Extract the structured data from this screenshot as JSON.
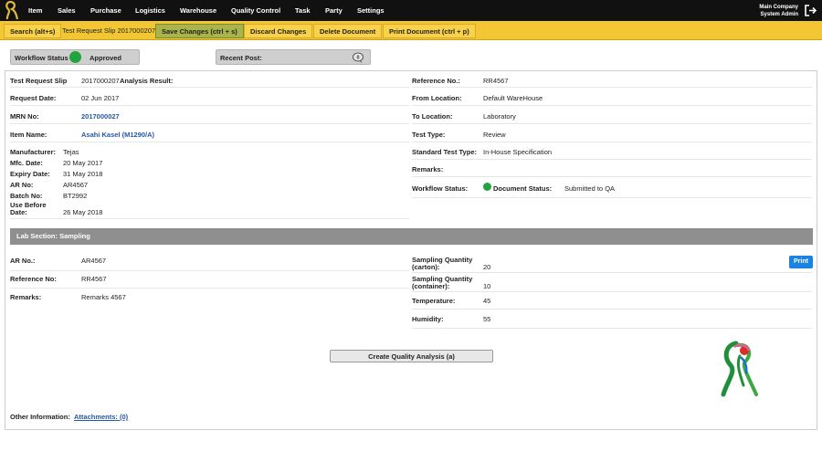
{
  "nav": {
    "items": [
      "Item",
      "Sales",
      "Purchase",
      "Logistics",
      "Warehouse",
      "Quality Control",
      "Task",
      "Party",
      "Settings"
    ],
    "company": "Main Company",
    "user": "System Admin"
  },
  "toolbar": {
    "search_label": "Search (alt+s)",
    "doc_label": "Test Request Slip 2017000207",
    "save_label": "Save Changes (ctrl + s)",
    "discard_label": "Discard Changes",
    "delete_label": "Delete Document",
    "print_label": "Print Document (ctrl + p)"
  },
  "status_bar": {
    "workflow_label": "Workflow Status",
    "workflow_value": "Approved",
    "recent_label": "Recent Post:",
    "recent_count": "0"
  },
  "left_info": {
    "slip_label": "Test Request Slip",
    "slip_number": "2017000207",
    "slip_suffix": "Analysis Result:",
    "request_date_label": "Request Date:",
    "request_date": "02 Jun 2017",
    "mrn_label": "MRN No:",
    "mrn": "2017000027",
    "item_label": "Item Name:",
    "item": "Asahi Kasel (M1290/A)",
    "manufacturer_label": "Manufacturer:",
    "manufacturer": "Tejas",
    "mfc_label": "Mfc. Date:",
    "mfc": "20 May 2017",
    "expiry_label": "Expiry Date:",
    "expiry": "31 May 2018",
    "ar_label": "AR No:",
    "ar": "AR4567",
    "batch_label": "Batch No:",
    "batch": "BT2992",
    "use_before_label1": "Use Before",
    "use_before_label2": "Date:",
    "use_before": "26 May 2018"
  },
  "right_info": {
    "reference_label": "Reference No.:",
    "reference": "RR4567",
    "from_label": "From Location:",
    "from": "Default WareHouse",
    "to_label": "To Location:",
    "to": "Laboratory",
    "test_type_label": "Test Type:",
    "test_type": "Review",
    "std_label": "Standard Test Type:",
    "std": "In-House Specification",
    "remarks_label": "Remarks:",
    "workflow_label": "Workflow Status:",
    "doc_status_label": "Document Status:",
    "doc_status": "Submitted to QA"
  },
  "lab": {
    "section_title": "Lab Section: Sampling",
    "ar_label": "AR No.:",
    "ar": "AR4567",
    "ref_label": "Reference No:",
    "ref": "RR4567",
    "remarks_label": "Remarks:",
    "remarks": "Remarks 4567",
    "carton_label1": "Sampling Quantity",
    "carton_label2": "(carton):",
    "carton": "20",
    "container_label1": "Sampling Quantity",
    "container_label2": "(container):",
    "container": "10",
    "temp_label": "Temperature:",
    "temp": "45",
    "humidity_label": "Humidity:",
    "humidity": "55",
    "print_label": "Print",
    "create_label": "Create Quality Analysis (a)"
  },
  "footer": {
    "other_label": "Other Information:",
    "attachments": "Attachments: (0)"
  },
  "colors": {
    "toolbar": "#f3c634",
    "save": "#a9b54a",
    "approved": "#22a33d",
    "link": "#2458a6",
    "print": "#1a82e0"
  }
}
